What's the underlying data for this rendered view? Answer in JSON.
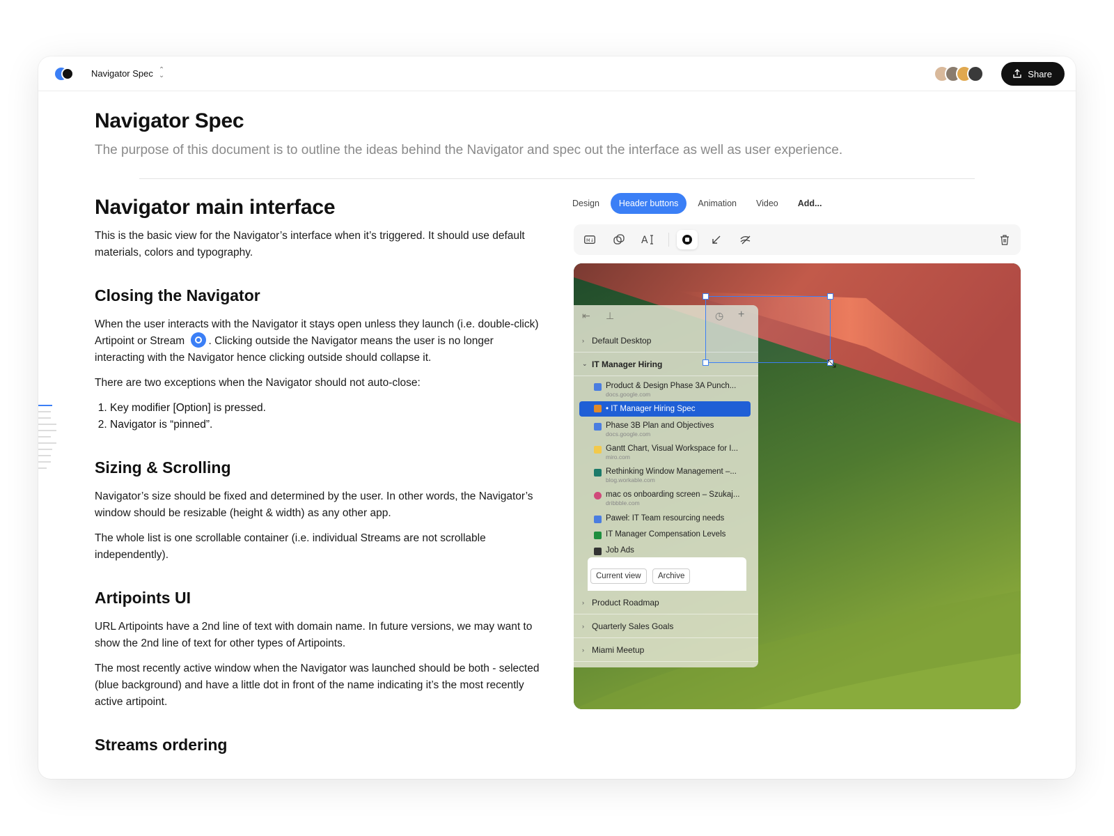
{
  "topbar": {
    "doc_name": "Navigator Spec",
    "share_label": "Share",
    "avatar_colors": [
      "#d9b99b",
      "#8a7c6e",
      "#e0a84f",
      "#3a3a3a"
    ]
  },
  "document": {
    "title": "Navigator Spec",
    "subtitle": "The purpose of this document is to outline the ideas behind the Navigator and spec out the interface as well as user experience.",
    "sections": {
      "main": {
        "heading": "Navigator main interface",
        "p1": "This is the basic view for the Navigator’s interface when it’s triggered. It should use default materials, colors and typography."
      },
      "closing": {
        "heading": "Closing the Navigator",
        "p1_a": "When the user interacts with the Navigator it stays open unless they launch (i.e. double-click) Artipoint or Stream",
        "p1_b": ". Clicking outside the Navigator means the user is no longer interacting with the Navigator hence clicking outside should collapse it.",
        "p2": "There are two exceptions when the Navigator should not auto-close:",
        "list": [
          "Key modifier [Option] is pressed.",
          "Navigator is “pinned”."
        ]
      },
      "sizing": {
        "heading": "Sizing & Scrolling",
        "p1": "Navigator’s size should be fixed and determined by the user. In other words, the Navigator’s window should be resizable (height & width) as any other app.",
        "p2": "The whole list is one scrollable container (i.e. individual Streams are not scrollable independently)."
      },
      "artipoints": {
        "heading": "Artipoints UI",
        "p1": "URL Artipoints have a 2nd line of text with domain name. In future versions, we may want to show the 2nd line of text for other types of Artipoints.",
        "p2": "The most recently active window when the Navigator was launched should be both - selected (blue background) and have a little dot in front of the name indicating it’s the most recently active artipoint."
      },
      "streams": {
        "heading": "Streams ordering"
      }
    }
  },
  "panel": {
    "tabs": [
      "Design",
      "Header buttons",
      "Animation",
      "Video",
      "Add..."
    ],
    "active_tab": "Header buttons",
    "navigator": {
      "groups": {
        "default_desktop": "Default Desktop",
        "it_manager": "IT Manager Hiring",
        "roadmap": "Product Roadmap",
        "sales": "Quarterly Sales Goals",
        "miami": "Miami Meetup"
      },
      "items": [
        {
          "title": "Product & Design Phase 3A Punch...",
          "domain": "docs.google.com",
          "color": "#4a7de0"
        },
        {
          "title": "• IT Manager Hiring Spec",
          "domain": "",
          "color": "#e08a2a"
        },
        {
          "title": "Phase 3B Plan and Objectives",
          "domain": "docs.google.com",
          "color": "#4a7de0"
        },
        {
          "title": "Gantt Chart, Visual Workspace for I...",
          "domain": "miro.com",
          "color": "#f2c94c"
        },
        {
          "title": "Rethinking Window Management –...",
          "domain": "blog.workable.com",
          "color": "#1d7a6a"
        },
        {
          "title": "mac os onboarding screen – Szukaj...",
          "domain": "dribbble.com",
          "color": "#d04a7a"
        },
        {
          "title": "Paweł: IT Team resourcing needs",
          "domain": "",
          "color": "#4a7de0"
        },
        {
          "title": "IT Manager Compensation Levels",
          "domain": "",
          "color": "#1e8e3e"
        },
        {
          "title": "Job Ads",
          "domain": "",
          "color": "#333333"
        }
      ],
      "segment": [
        "Current view",
        "Archive"
      ]
    }
  },
  "colors": {
    "accent": "#3b7ff6",
    "selected": "#1f5fd6"
  }
}
